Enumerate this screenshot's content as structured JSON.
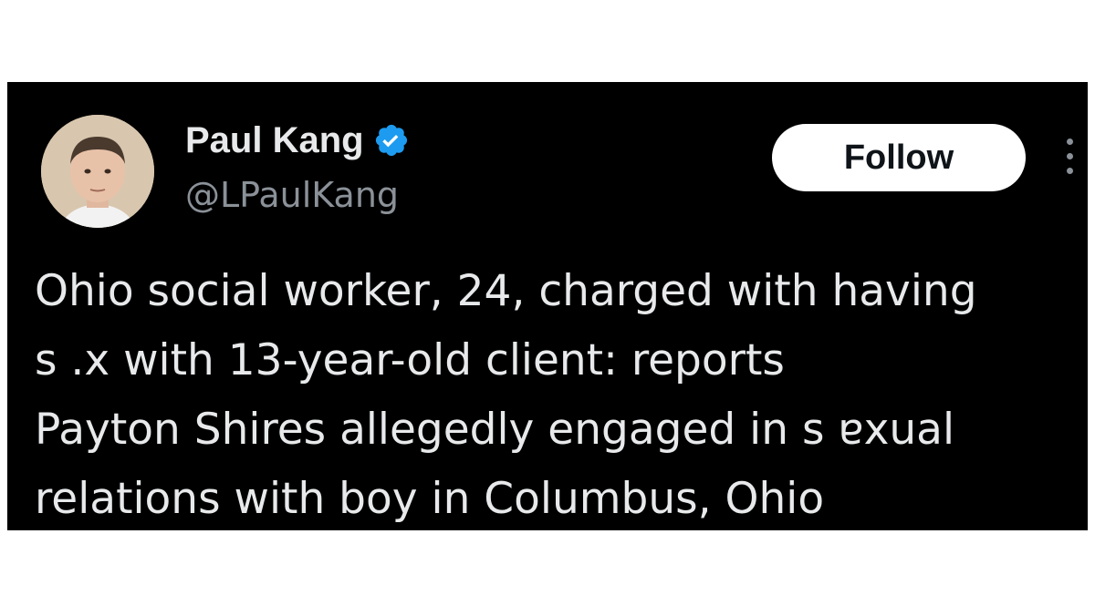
{
  "tweet": {
    "author": {
      "display_name": "Paul Kang",
      "handle": "@LPaulKang",
      "verified": true,
      "avatar_icon": "profile-photo"
    },
    "follow_label": "Follow",
    "more_icon": "vertical-ellipsis-icon",
    "text_lines": [
      "Ohio social worker, 24, charged with having",
      "s .x with 13-year-old client: reports",
      "Payton Shires allegedly engaged in s ɐxual",
      "relations with boy in Columbus, Ohio"
    ]
  },
  "colors": {
    "tweet_background": "#000000",
    "primary_text": "#e7e9ea",
    "secondary_text": "#8b9198",
    "verified_blue": "#1d9bf0",
    "follow_button_bg": "#ffffff"
  }
}
